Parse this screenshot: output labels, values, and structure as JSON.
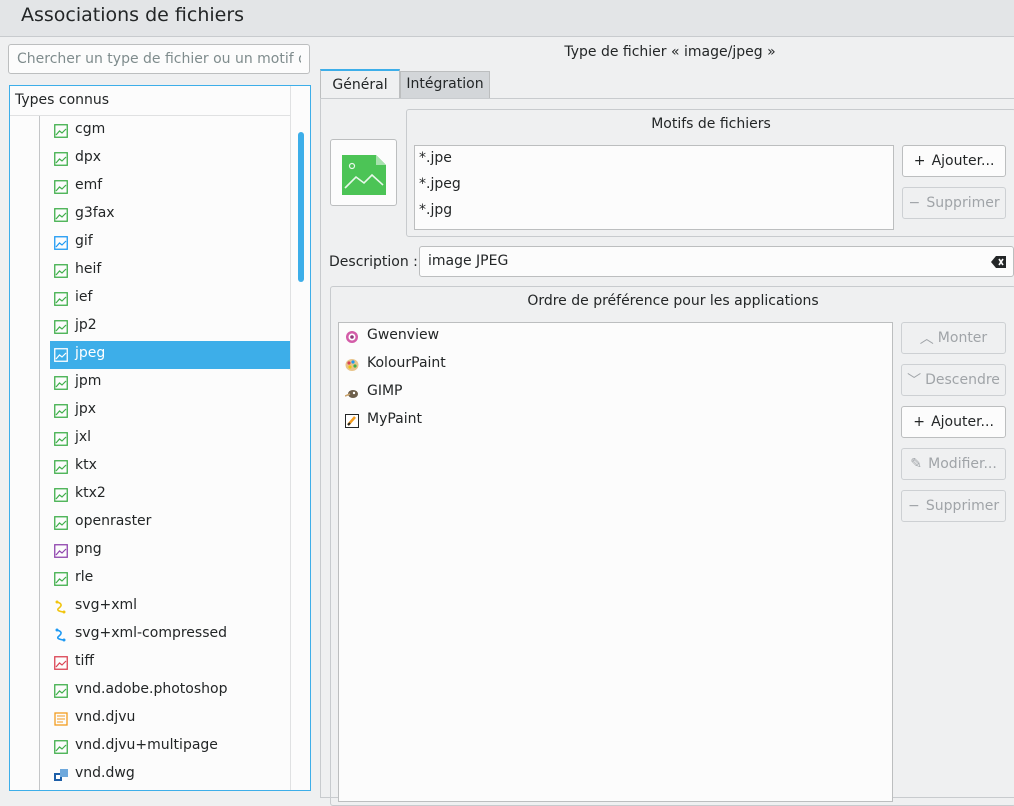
{
  "window": {
    "title": "Associations de fichiers"
  },
  "search": {
    "placeholder": "Chercher un type de fichier ou un motif de..."
  },
  "tree": {
    "header": "Types connus",
    "items": [
      {
        "label": "cgm",
        "icon": "image-icon",
        "color": "#3fae4a"
      },
      {
        "label": "dpx",
        "icon": "image-icon",
        "color": "#3fae4a"
      },
      {
        "label": "emf",
        "icon": "image-icon",
        "color": "#3fae4a"
      },
      {
        "label": "g3fax",
        "icon": "image-icon",
        "color": "#3fae4a"
      },
      {
        "label": "gif",
        "icon": "image-icon",
        "color": "#1d99f3"
      },
      {
        "label": "heif",
        "icon": "image-icon",
        "color": "#3fae4a"
      },
      {
        "label": "ief",
        "icon": "image-icon",
        "color": "#3fae4a"
      },
      {
        "label": "jp2",
        "icon": "image-icon",
        "color": "#3fae4a"
      },
      {
        "label": "jpeg",
        "icon": "image-icon",
        "color": "#3fae4a",
        "selected": true
      },
      {
        "label": "jpm",
        "icon": "image-icon",
        "color": "#3fae4a"
      },
      {
        "label": "jpx",
        "icon": "image-icon",
        "color": "#3fae4a"
      },
      {
        "label": "jxl",
        "icon": "image-icon",
        "color": "#3fae4a"
      },
      {
        "label": "ktx",
        "icon": "image-icon",
        "color": "#3fae4a"
      },
      {
        "label": "ktx2",
        "icon": "image-icon",
        "color": "#3fae4a"
      },
      {
        "label": "openraster",
        "icon": "image-icon",
        "color": "#3fae4a"
      },
      {
        "label": "png",
        "icon": "image-icon",
        "color": "#8e44ad"
      },
      {
        "label": "rle",
        "icon": "image-icon",
        "color": "#3fae4a"
      },
      {
        "label": "svg+xml",
        "icon": "vector-icon",
        "color": "#f1c40f"
      },
      {
        "label": "svg+xml-compressed",
        "icon": "vector-icon",
        "color": "#1d99f3"
      },
      {
        "label": "tiff",
        "icon": "image-icon",
        "color": "#da4453"
      },
      {
        "label": "vnd.adobe.photoshop",
        "icon": "image-icon",
        "color": "#3fae4a"
      },
      {
        "label": "vnd.djvu",
        "icon": "document-icon",
        "color": "#f39c1f"
      },
      {
        "label": "vnd.djvu+multipage",
        "icon": "image-icon",
        "color": "#3fae4a"
      },
      {
        "label": "vnd.dwg",
        "icon": "cad-icon",
        "color": "#1d5fa8"
      }
    ]
  },
  "pane": {
    "title": "Type de fichier « image/jpeg »",
    "tabs": {
      "general": "Général",
      "integration": "Intégration"
    },
    "patterns": {
      "title": "Motifs de fichiers",
      "items": [
        "*.jpe",
        "*.jpeg",
        "*.jpg"
      ],
      "add": "Ajouter...",
      "remove": "Supprimer"
    },
    "description": {
      "label": "Description :",
      "value": "image JPEG"
    },
    "apps": {
      "title": "Ordre de préférence pour les applications",
      "items": [
        {
          "label": "Gwenview",
          "icon": "gwenview-icon"
        },
        {
          "label": "KolourPaint",
          "icon": "kolourpaint-icon"
        },
        {
          "label": "GIMP",
          "icon": "gimp-icon"
        },
        {
          "label": "MyPaint",
          "icon": "mypaint-icon"
        }
      ],
      "up": "Monter",
      "down": "Descendre",
      "add": "Ajouter...",
      "edit": "Modifier...",
      "remove": "Supprimer"
    }
  }
}
